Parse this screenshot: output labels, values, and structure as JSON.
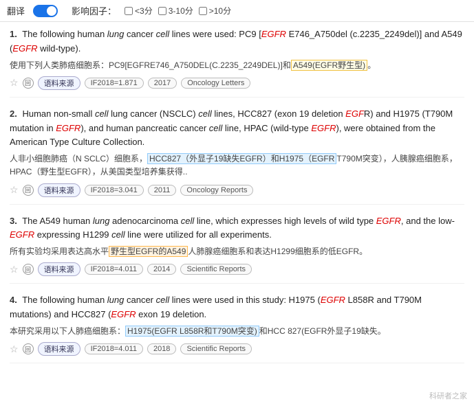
{
  "toolbar": {
    "translate_label": "翻译",
    "toggle_state": "on",
    "influence_label": "影响因子：",
    "filters": [
      {
        "label": "<3分",
        "checked": false
      },
      {
        "label": "3-10分",
        "checked": false
      },
      {
        "label": ">10分",
        "checked": false
      }
    ]
  },
  "results": [
    {
      "number": "1.",
      "en_parts": [
        {
          "text": "The following human ",
          "style": "normal"
        },
        {
          "text": "lung",
          "style": "italic"
        },
        {
          "text": " cancer ",
          "style": "normal"
        },
        {
          "text": "cell",
          "style": "italic"
        },
        {
          "text": " lines were used: PC9 [",
          "style": "normal"
        },
        {
          "text": "EGFR",
          "style": "italic-red"
        },
        {
          "text": " E746_A750del (c.2235_2249del)] and A549 (",
          "style": "normal"
        },
        {
          "text": "EGFR",
          "style": "italic-red"
        },
        {
          "text": " wild-type).",
          "style": "normal"
        }
      ],
      "zh_parts": [
        {
          "text": "使用下列人类肺癌细胞系：PC9[EGFRE746_A750DEL(C.2235_2249DEL)]和",
          "style": "normal"
        },
        {
          "text": "A549(EGFR野生型)",
          "style": "highlight-box"
        },
        {
          "text": "。",
          "style": "normal"
        }
      ],
      "meta": {
        "if": "IF2018=1.871",
        "year": "2017",
        "journal": "Oncology Letters"
      }
    },
    {
      "number": "2.",
      "en_parts": [
        {
          "text": "Human non-small ",
          "style": "normal"
        },
        {
          "text": "cell",
          "style": "italic"
        },
        {
          "text": " lung cancer (NSCLC) ",
          "style": "normal"
        },
        {
          "text": "cell",
          "style": "italic"
        },
        {
          "text": " lines, HCC827 (exon 19 deletion ",
          "style": "normal"
        },
        {
          "text": "EGF",
          "style": "italic-red"
        },
        {
          "text": "R) and H1975 (T790M mutation in ",
          "style": "normal"
        },
        {
          "text": "EGFR",
          "style": "italic-red"
        },
        {
          "text": "), and human pancreatic cancer ",
          "style": "normal"
        },
        {
          "text": "cell",
          "style": "italic"
        },
        {
          "text": " line, HPAC (wild-type ",
          "style": "normal"
        },
        {
          "text": "EGFR",
          "style": "italic-red"
        },
        {
          "text": "), were obtained from the American Type Culture Collection.",
          "style": "normal"
        }
      ],
      "zh_parts": [
        {
          "text": "人非小细胞肺癌（N SCLC）细胞系，",
          "style": "normal"
        },
        {
          "text": "HCC827（外显子19缺失EGFR）和H1975（EGFR",
          "style": "highlight-blue"
        },
        {
          "text": "T790M突变），人胰腺癌细胞系，HPAC（野生型EGFR），从美国类型培养集获得..",
          "style": "normal"
        }
      ],
      "meta": {
        "if": "IF2018=3.041",
        "year": "2011",
        "journal": "Oncology Reports"
      }
    },
    {
      "number": "3.",
      "en_parts": [
        {
          "text": "The A549 human ",
          "style": "normal"
        },
        {
          "text": "lung",
          "style": "italic"
        },
        {
          "text": " adenocarcinoma ",
          "style": "normal"
        },
        {
          "text": "cell",
          "style": "italic"
        },
        {
          "text": " line, which expresses high levels of wild type ",
          "style": "normal"
        },
        {
          "text": "EGFR",
          "style": "italic-red"
        },
        {
          "text": ", and the low-",
          "style": "normal"
        },
        {
          "text": "EGFR",
          "style": "italic-red"
        },
        {
          "text": " expressing H1299 ",
          "style": "normal"
        },
        {
          "text": "cell",
          "style": "italic"
        },
        {
          "text": " line were utilized for all experiments.",
          "style": "normal"
        }
      ],
      "zh_parts": [
        {
          "text": "所有实验均采用表达高水平",
          "style": "normal"
        },
        {
          "text": "野生型EGFR的A549",
          "style": "highlight-orange"
        },
        {
          "text": "人肺腺癌细胞系和表达H1299细胞系的低EGFR。",
          "style": "normal"
        }
      ],
      "meta": {
        "if": "IF2018=4.011",
        "year": "2014",
        "journal": "Scientific Reports"
      }
    },
    {
      "number": "4.",
      "en_parts": [
        {
          "text": "The following human ",
          "style": "normal"
        },
        {
          "text": "lung",
          "style": "italic"
        },
        {
          "text": " cancer ",
          "style": "normal"
        },
        {
          "text": "cell",
          "style": "italic"
        },
        {
          "text": " lines were used in this study: H1975 (",
          "style": "normal"
        },
        {
          "text": "EGFR",
          "style": "italic-red"
        },
        {
          "text": " L858R and T790M mutations) and HCC827 (",
          "style": "normal"
        },
        {
          "text": "EGFR",
          "style": "italic-red"
        },
        {
          "text": " exon 19 deletion.",
          "style": "normal"
        }
      ],
      "zh_parts": [
        {
          "text": "本研究采用以下人肺癌细胞系：",
          "style": "normal"
        },
        {
          "text": "H1975(EGFR L858R和T790M突变)",
          "style": "highlight-blue"
        },
        {
          "text": "和HCC 827(EGFR外显子19缺失。",
          "style": "normal"
        }
      ],
      "meta": {
        "if": "IF2018=4.011",
        "year": "2018",
        "journal": "Scientific Reports"
      }
    }
  ],
  "watermark": "科研者之家",
  "ui": {
    "source_label": "语料来源"
  }
}
